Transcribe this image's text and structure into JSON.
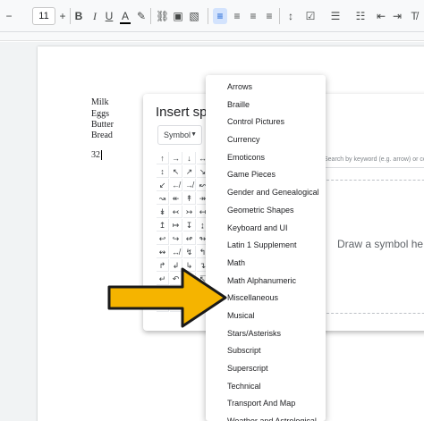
{
  "toolbar": {
    "font_size": "11",
    "items": [
      {
        "name": "decrease-font-size-button",
        "glyph": "−"
      },
      {
        "name": "increase-font-size-button",
        "glyph": "+"
      },
      {
        "name": "bold-button",
        "glyph": "B"
      },
      {
        "name": "italic-button",
        "glyph": "I"
      },
      {
        "name": "underline-button",
        "glyph": "U"
      },
      {
        "name": "text-color-button",
        "glyph": "A"
      },
      {
        "name": "highlight-button",
        "glyph": "✎"
      },
      {
        "name": "insert-link-button",
        "glyph": "⛓"
      },
      {
        "name": "insert-comment-button",
        "glyph": "▣"
      },
      {
        "name": "insert-image-button",
        "glyph": "▧"
      },
      {
        "name": "align-left-button",
        "glyph": "≡"
      },
      {
        "name": "align-center-button",
        "glyph": "≡"
      },
      {
        "name": "align-right-button",
        "glyph": "≡"
      },
      {
        "name": "justify-button",
        "glyph": "≡"
      },
      {
        "name": "line-spacing-button",
        "glyph": "↕"
      },
      {
        "name": "checklist-button",
        "glyph": "☑"
      },
      {
        "name": "bulleted-list-button",
        "glyph": "☰"
      },
      {
        "name": "numbered-list-button",
        "glyph": "☷"
      },
      {
        "name": "decrease-indent-button",
        "glyph": "⇤"
      },
      {
        "name": "increase-indent-button",
        "glyph": "⇥"
      },
      {
        "name": "clear-formatting-button",
        "glyph": "T̸"
      }
    ]
  },
  "document": {
    "lines": [
      "Milk",
      "Eggs",
      "Butter",
      "Bread"
    ],
    "typed": "32"
  },
  "dialog": {
    "title": "Insert spe",
    "category_select": "Symbol",
    "search_placeholder": "Search by keyword (e.g. arrow) or co",
    "draw_hint": "Draw a symbol he",
    "symbols": [
      "↑",
      "→",
      "↓",
      "↔",
      "↕",
      "↖",
      "↗",
      "↘",
      "↙",
      "↚",
      "↛",
      "↜",
      "↝",
      "↞",
      "↟",
      "↠",
      "↡",
      "↢",
      "↣",
      "↤",
      "↥",
      "↦",
      "↧",
      "↨",
      "↩",
      "↪",
      "↫",
      "↬",
      "↭",
      "↮",
      "↯",
      "↰",
      "↱",
      "↲",
      "↳",
      "↴",
      "↵",
      "↶",
      "↷",
      "↸",
      "↹",
      "↺",
      "↻",
      "⇄",
      "⇆",
      "⇇",
      "⇈",
      "⇉"
    ]
  },
  "menu": {
    "items": [
      "Arrows",
      "Braille",
      "Control Pictures",
      "Currency",
      "Emoticons",
      "Game Pieces",
      "Gender and Genealogical",
      "Geometric Shapes",
      "Keyboard and UI",
      "Latin 1 Supplement",
      "Math",
      "Math Alphanumeric",
      "Miscellaneous",
      "Musical",
      "Stars/Asterisks",
      "Subscript",
      "Superscript",
      "Technical",
      "Transport And Map",
      "Weather and Astrological"
    ]
  },
  "colors": {
    "arrow_fill": "#f5b400",
    "arrow_stroke": "#1a1a1a",
    "accent": "#0b57d0"
  },
  "icons": {
    "arrow": "annotation-arrow-icon"
  }
}
